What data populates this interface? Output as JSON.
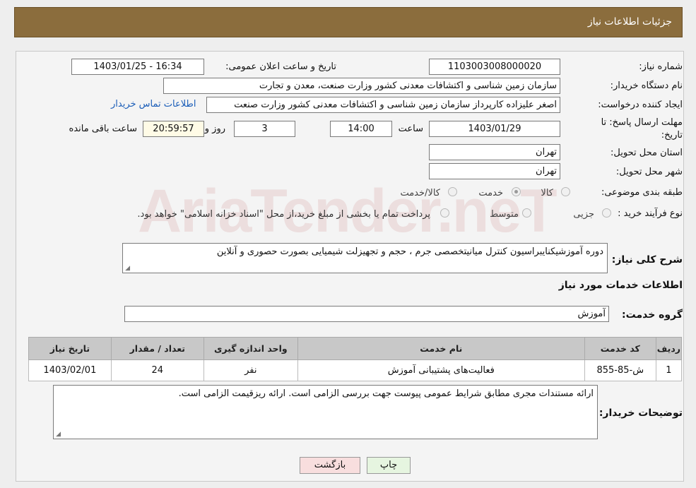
{
  "header": {
    "title": "جزئیات اطلاعات نیاز"
  },
  "form": {
    "need_number_label": "شماره نیاز:",
    "need_number": "1103003008000020",
    "announce_label": "تاریخ و ساعت اعلان عمومی:",
    "announce_value": "1403/01/25 - 16:34",
    "buyer_org_label": "نام دستگاه خریدار:",
    "buyer_org": "سازمان زمین شناسی و اکتشافات معدنی کشور وزارت صنعت، معدن و تجارت",
    "creator_label": "ایجاد کننده درخواست:",
    "creator": "اصغر علیزاده کارپرداز سازمان زمین شناسی و اکتشافات معدنی کشور وزارت صنعت",
    "contact_link": "اطلاعات تماس خریدار",
    "deadline_label_1": "مهلت ارسال پاسخ: تا",
    "deadline_label_2": "تاریخ:",
    "deadline_date": "1403/01/29",
    "time_label": "ساعت",
    "deadline_time": "14:00",
    "days_value": "3",
    "days_label": "روز و",
    "remaining_time": "20:59:57",
    "remaining_label": "ساعت باقی مانده",
    "province_label": "استان محل تحویل:",
    "province": "تهران",
    "city_label": "شهر محل تحویل:",
    "city": "تهران",
    "category_label": "طبقه بندی موضوعی:",
    "category_options": [
      "کالا",
      "خدمت",
      "کالا/خدمت"
    ],
    "category_selected": "خدمت",
    "process_label": "نوع فرآیند خرید :",
    "process_options": [
      "جزیی",
      "متوسط"
    ],
    "process_note": "پرداخت تمام یا بخشی از مبلغ خرید،از محل \"اسناد خزانه اسلامی\" خواهد بود."
  },
  "description": {
    "label": "شرح کلی نیاز:",
    "text": "دوره آموزشیکنایبراسیون کنترل میانیتخصصی جرم ، حجم و تجهیزلت شیمیایی بصورت حصوری و آنلاین"
  },
  "services": {
    "section_title": "اطلاعات خدمات مورد نیاز",
    "group_label": "گروه خدمت:",
    "group_value": "آموزش",
    "columns": [
      "ردیف",
      "کد خدمت",
      "نام خدمت",
      "واحد اندازه گیری",
      "تعداد / مقدار",
      "تاریخ نیاز"
    ],
    "rows": [
      [
        "1",
        "ش-85-855",
        "فعالیت‌های پشتیبانی آموزش",
        "نفر",
        "24",
        "1403/02/01"
      ]
    ]
  },
  "buyer_notes": {
    "label": "توضیحات خریدار:",
    "text": "ارائه مستندات مجری مطابق شرایط عمومی پیوست جهت بررسی الزامی است. ارائه ریزقیمت الزامی است."
  },
  "buttons": {
    "print": "چاپ",
    "back": "بازگشت"
  },
  "watermark": "AriaTender.neT",
  "colors": {
    "header_bg": "#8b6d3d",
    "link": "#1a5db8",
    "back_button": "#f8dede",
    "print_button": "#e6f5e0"
  }
}
